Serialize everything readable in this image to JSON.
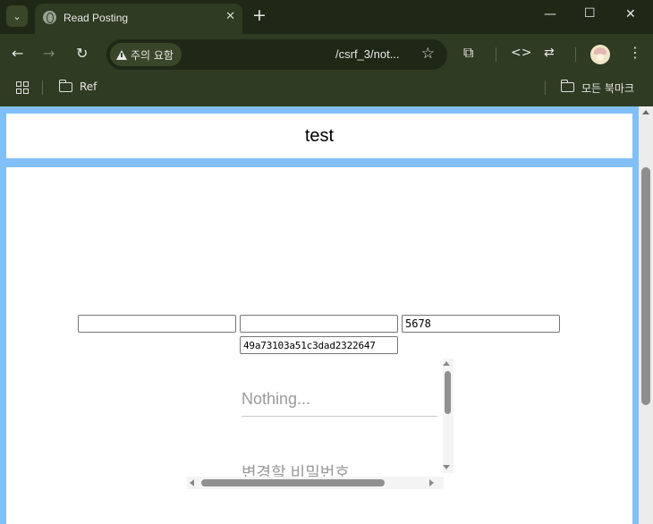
{
  "browser": {
    "tab": {
      "title": "Read Posting",
      "close_glyph": "✕"
    },
    "tab_menu_glyph": "⌄",
    "new_tab_glyph": "+",
    "window_controls": {
      "minimize": "—",
      "maximize": "☐",
      "close": "✕"
    },
    "nav": {
      "back": "←",
      "forward": "→",
      "reload": "↻"
    },
    "omnibox": {
      "security_label": "주의 요함",
      "url": "/csrf_3/not...",
      "bookmark_star": "☆"
    },
    "toolbar_icons": {
      "extensions": "⧉",
      "devtools": "<>",
      "translate": "⇄",
      "menu": "⋮"
    },
    "bookmarks": {
      "folder": "Ref",
      "all_bookmarks": "모든 북마크"
    }
  },
  "page": {
    "heading": "test",
    "form": {
      "field1_value": "",
      "field2_value": "",
      "field3_value": "5678",
      "token_value": "49a73103a51c3dad2322647"
    },
    "pane": {
      "first_placeholder": "Nothing...",
      "password_placeholder": "변경할 비밀번호"
    }
  }
}
